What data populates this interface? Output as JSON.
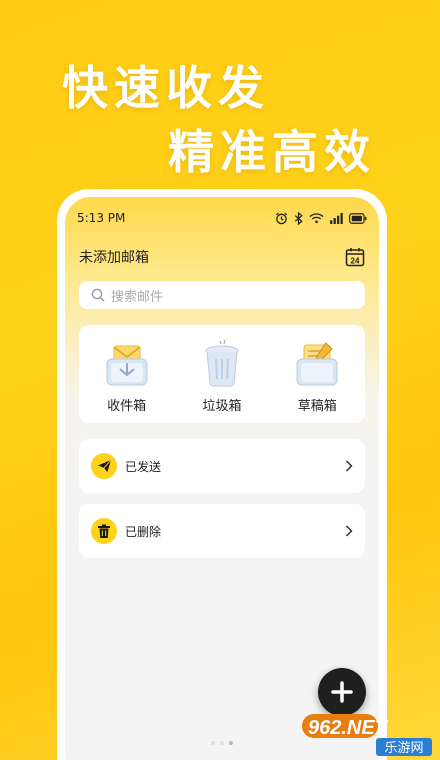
{
  "promo": {
    "line1": "快速收发",
    "line2": "精准高效"
  },
  "status_bar": {
    "time": "5:13 PM"
  },
  "topbar": {
    "title": "未添加邮箱",
    "calendar_day": "24"
  },
  "search": {
    "placeholder": "搜索邮件"
  },
  "folders": [
    {
      "label": "收件箱"
    },
    {
      "label": "垃圾箱"
    },
    {
      "label": "草稿箱"
    }
  ],
  "rows": {
    "sent": "已发送",
    "deleted": "已删除"
  },
  "watermark": {
    "brand": "962.NET",
    "sub": "乐游网"
  },
  "colors": {
    "accent": "#ffd21a",
    "background": "#f4f4f4"
  }
}
